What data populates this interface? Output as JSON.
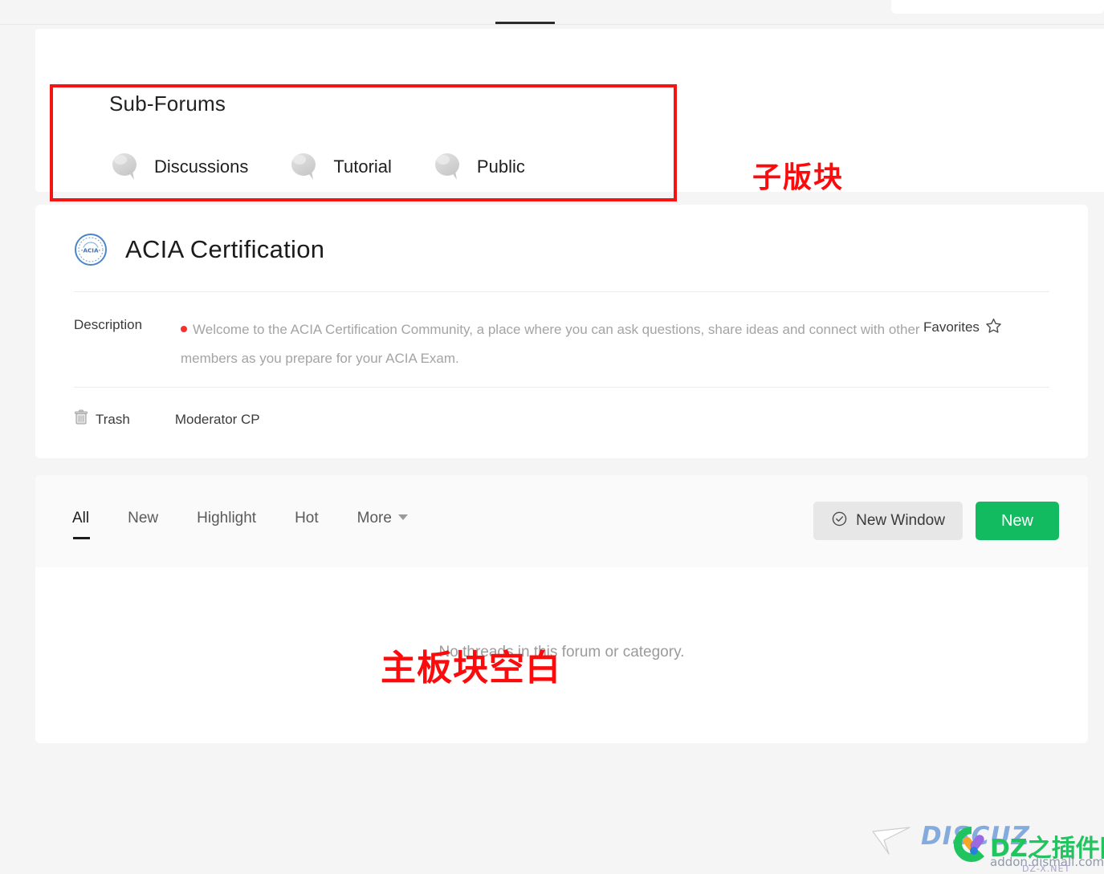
{
  "page": {
    "background_color": "#f5f5f5",
    "card_background": "#ffffff"
  },
  "subforums_section": {
    "title": "Sub-Forums",
    "items": [
      {
        "label": "Discussions",
        "icon": "speech-bubble-icon"
      },
      {
        "label": "Tutorial",
        "icon": "speech-bubble-icon"
      },
      {
        "label": "Public",
        "icon": "speech-bubble-icon"
      }
    ]
  },
  "annotations": {
    "color": "#fb0b0b",
    "subforum_label": "子版块",
    "main_board_label": "主板块空白"
  },
  "forum": {
    "logo_alt": "ACIA seal logo",
    "name": "ACIA Certification",
    "description_label": "Description",
    "description_text": "Welcome to the ACIA Certification Community, a place where you can ask questions, share ideas and connect with other members as you prepare for your ACIA Exam.",
    "favorites_label": "Favorites",
    "favorites_icon": "star-outline-icon",
    "trash_label": "Trash",
    "trash_icon": "trash-icon",
    "moderator_cp_label": "Moderator CP"
  },
  "thread_list": {
    "filters": [
      {
        "label": "All",
        "active": true
      },
      {
        "label": "New",
        "active": false
      },
      {
        "label": "Highlight",
        "active": false
      },
      {
        "label": "Hot",
        "active": false
      },
      {
        "label": "More",
        "active": false,
        "has_caret": true
      }
    ],
    "new_window_button": "New Window",
    "new_window_icon": "check-circle-icon",
    "new_button": "New",
    "new_button_color": "#12bb5f",
    "empty_message": "No threads in this forum or category."
  },
  "watermark": {
    "brand": "DISCUZ",
    "chinese": "DZ之插件网",
    "url": "addon.dismall.com",
    "sub": "DZ-X.NET",
    "cursor_icon": "cursor-arrow-icon"
  }
}
